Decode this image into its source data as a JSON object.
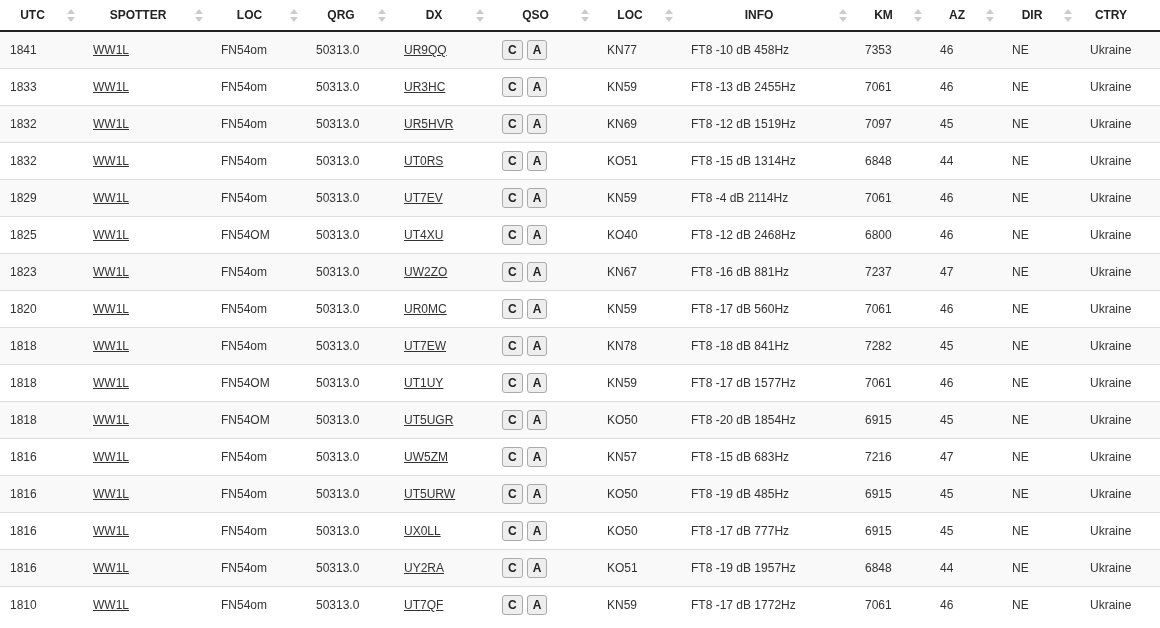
{
  "table": {
    "columns": [
      {
        "label": "UTC",
        "sortable": true
      },
      {
        "label": "SPOTTER",
        "sortable": true
      },
      {
        "label": "LOC",
        "sortable": true
      },
      {
        "label": "QRG",
        "sortable": true
      },
      {
        "label": "DX",
        "sortable": true
      },
      {
        "label": "QSO",
        "sortable": true
      },
      {
        "label": "LOC",
        "sortable": true
      },
      {
        "label": "INFO",
        "sortable": true
      },
      {
        "label": "KM",
        "sortable": true
      },
      {
        "label": "AZ",
        "sortable": true
      },
      {
        "label": "DIR",
        "sortable": true
      },
      {
        "label": "CTRY",
        "sortable": false
      }
    ],
    "rows": [
      {
        "utc": "1841",
        "spotter": "WW1L",
        "spotter_loc": "FN54om",
        "qrg": "50313.0",
        "dx": "UR9QQ",
        "qso": [
          "C",
          "A"
        ],
        "dx_loc": "KN77",
        "info": "FT8 -10 dB 458Hz",
        "km": "7353",
        "az": "46",
        "dir": "NE",
        "ctry": "Ukraine"
      },
      {
        "utc": "1833",
        "spotter": "WW1L",
        "spotter_loc": "FN54om",
        "qrg": "50313.0",
        "dx": "UR3HC",
        "qso": [
          "C",
          "A"
        ],
        "dx_loc": "KN59",
        "info": "FT8 -13 dB 2455Hz",
        "km": "7061",
        "az": "46",
        "dir": "NE",
        "ctry": "Ukraine"
      },
      {
        "utc": "1832",
        "spotter": "WW1L",
        "spotter_loc": "FN54om",
        "qrg": "50313.0",
        "dx": "UR5HVR",
        "qso": [
          "C",
          "A"
        ],
        "dx_loc": "KN69",
        "info": "FT8 -12 dB 1519Hz",
        "km": "7097",
        "az": "45",
        "dir": "NE",
        "ctry": "Ukraine"
      },
      {
        "utc": "1832",
        "spotter": "WW1L",
        "spotter_loc": "FN54om",
        "qrg": "50313.0",
        "dx": "UT0RS",
        "qso": [
          "C",
          "A"
        ],
        "dx_loc": "KO51",
        "info": "FT8 -15 dB 1314Hz",
        "km": "6848",
        "az": "44",
        "dir": "NE",
        "ctry": "Ukraine"
      },
      {
        "utc": "1829",
        "spotter": "WW1L",
        "spotter_loc": "FN54om",
        "qrg": "50313.0",
        "dx": "UT7EV",
        "qso": [
          "C",
          "A"
        ],
        "dx_loc": "KN59",
        "info": "FT8 -4 dB 2114Hz",
        "km": "7061",
        "az": "46",
        "dir": "NE",
        "ctry": "Ukraine"
      },
      {
        "utc": "1825",
        "spotter": "WW1L",
        "spotter_loc": "FN54OM",
        "qrg": "50313.0",
        "dx": "UT4XU",
        "qso": [
          "C",
          "A"
        ],
        "dx_loc": "KO40",
        "info": "FT8 -12 dB 2468Hz",
        "km": "6800",
        "az": "46",
        "dir": "NE",
        "ctry": "Ukraine"
      },
      {
        "utc": "1823",
        "spotter": "WW1L",
        "spotter_loc": "FN54om",
        "qrg": "50313.0",
        "dx": "UW2ZO",
        "qso": [
          "C",
          "A"
        ],
        "dx_loc": "KN67",
        "info": "FT8 -16 dB 881Hz",
        "km": "7237",
        "az": "47",
        "dir": "NE",
        "ctry": "Ukraine"
      },
      {
        "utc": "1820",
        "spotter": "WW1L",
        "spotter_loc": "FN54om",
        "qrg": "50313.0",
        "dx": "UR0MC",
        "qso": [
          "C",
          "A"
        ],
        "dx_loc": "KN59",
        "info": "FT8 -17 dB 560Hz",
        "km": "7061",
        "az": "46",
        "dir": "NE",
        "ctry": "Ukraine"
      },
      {
        "utc": "1818",
        "spotter": "WW1L",
        "spotter_loc": "FN54om",
        "qrg": "50313.0",
        "dx": "UT7EW",
        "qso": [
          "C",
          "A"
        ],
        "dx_loc": "KN78",
        "info": "FT8 -18 dB 841Hz",
        "km": "7282",
        "az": "45",
        "dir": "NE",
        "ctry": "Ukraine"
      },
      {
        "utc": "1818",
        "spotter": "WW1L",
        "spotter_loc": "FN54OM",
        "qrg": "50313.0",
        "dx": "UT1UY",
        "qso": [
          "C",
          "A"
        ],
        "dx_loc": "KN59",
        "info": "FT8 -17 dB 1577Hz",
        "km": "7061",
        "az": "46",
        "dir": "NE",
        "ctry": "Ukraine"
      },
      {
        "utc": "1818",
        "spotter": "WW1L",
        "spotter_loc": "FN54OM",
        "qrg": "50313.0",
        "dx": "UT5UGR",
        "qso": [
          "C",
          "A"
        ],
        "dx_loc": "KO50",
        "info": "FT8 -20 dB 1854Hz",
        "km": "6915",
        "az": "45",
        "dir": "NE",
        "ctry": "Ukraine"
      },
      {
        "utc": "1816",
        "spotter": "WW1L",
        "spotter_loc": "FN54om",
        "qrg": "50313.0",
        "dx": "UW5ZM",
        "qso": [
          "C",
          "A"
        ],
        "dx_loc": "KN57",
        "info": "FT8 -15 dB 683Hz",
        "km": "7216",
        "az": "47",
        "dir": "NE",
        "ctry": "Ukraine"
      },
      {
        "utc": "1816",
        "spotter": "WW1L",
        "spotter_loc": "FN54om",
        "qrg": "50313.0",
        "dx": "UT5URW",
        "qso": [
          "C",
          "A"
        ],
        "dx_loc": "KO50",
        "info": "FT8 -19 dB 485Hz",
        "km": "6915",
        "az": "45",
        "dir": "NE",
        "ctry": "Ukraine"
      },
      {
        "utc": "1816",
        "spotter": "WW1L",
        "spotter_loc": "FN54om",
        "qrg": "50313.0",
        "dx": "UX0LL",
        "qso": [
          "C",
          "A"
        ],
        "dx_loc": "KO50",
        "info": "FT8 -17 dB 777Hz",
        "km": "6915",
        "az": "45",
        "dir": "NE",
        "ctry": "Ukraine"
      },
      {
        "utc": "1816",
        "spotter": "WW1L",
        "spotter_loc": "FN54om",
        "qrg": "50313.0",
        "dx": "UY2RA",
        "qso": [
          "C",
          "A"
        ],
        "dx_loc": "KO51",
        "info": "FT8 -19 dB 1957Hz",
        "km": "6848",
        "az": "44",
        "dir": "NE",
        "ctry": "Ukraine"
      },
      {
        "utc": "1810",
        "spotter": "WW1L",
        "spotter_loc": "FN54om",
        "qrg": "50313.0",
        "dx": "UT7QF",
        "qso": [
          "C",
          "A"
        ],
        "dx_loc": "KN59",
        "info": "FT8 -17 dB 1772Hz",
        "km": "7061",
        "az": "46",
        "dir": "NE",
        "ctry": "Ukraine"
      }
    ]
  }
}
